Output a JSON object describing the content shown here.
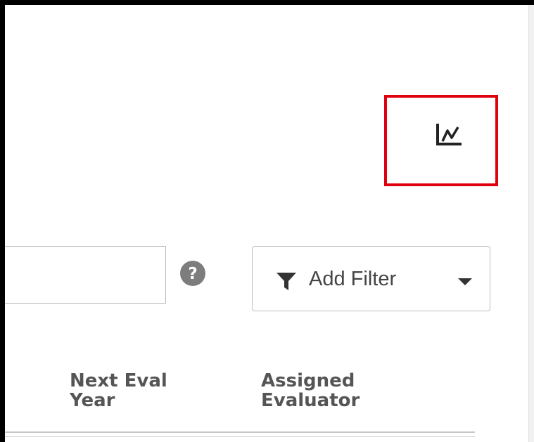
{
  "toolbar": {
    "chart_icon": "line-chart-icon",
    "highlight_color": "#e0000f"
  },
  "search": {
    "value": "",
    "placeholder": "",
    "help_icon": "question-circle-icon"
  },
  "filter": {
    "label": "Add Filter",
    "icon": "filter-funnel-icon",
    "dropdown_icon": "caret-down-icon"
  },
  "table": {
    "headers": [
      {
        "line1": "Next Eval",
        "line2": "Year"
      },
      {
        "line1": "Assigned",
        "line2": "Evaluator"
      }
    ]
  }
}
